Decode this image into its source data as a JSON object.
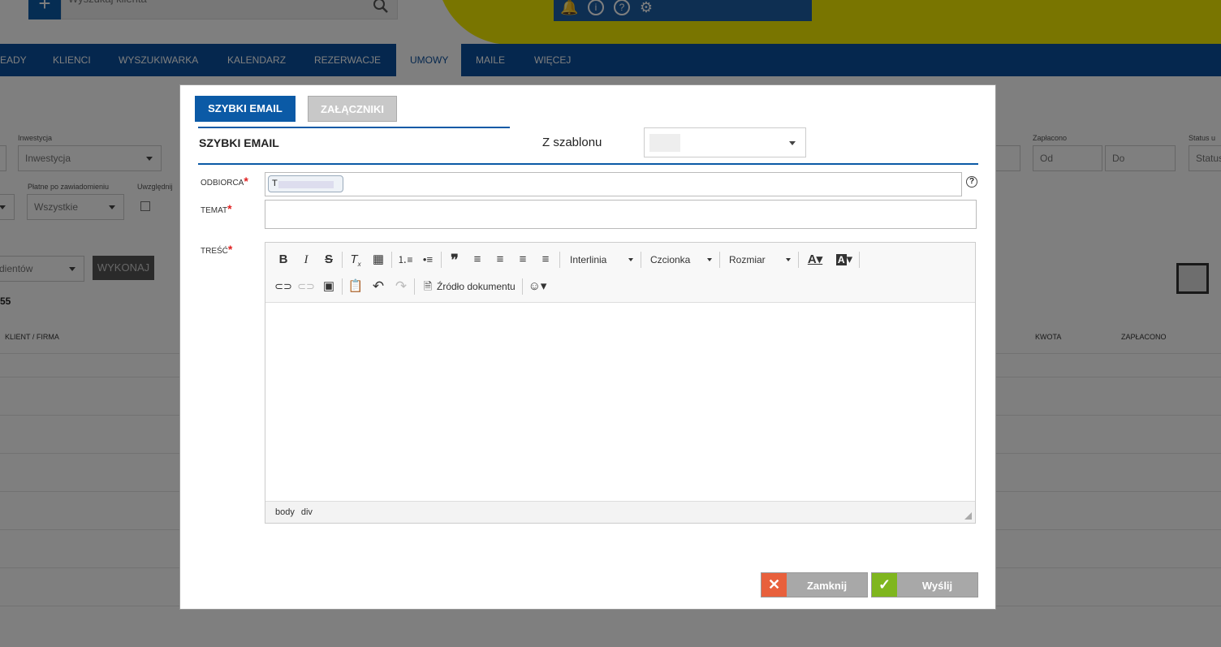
{
  "app": {
    "search_placeholder": "Wyszukaj klienta",
    "add_label": "+",
    "nav": [
      "EADY",
      "KLIENCI",
      "WYSZUKIWARKA",
      "KALENDARZ",
      "REZERWACJE",
      "UMOWY",
      "MAILE",
      "WIĘCEJ"
    ],
    "active_nav": "UMOWY"
  },
  "filters": {
    "investment_label": "Inwestycja",
    "investment_value": "Inwestycja",
    "paid_after_label": "Płatne po zawiadomieniu",
    "paid_after_value": "Wszystkie",
    "include_label": "Uwzględnij",
    "paid_label": "Zapłacono",
    "from_placeholder": "Od",
    "to_placeholder": "Do",
    "status_label": "Status u",
    "status_value": "Status",
    "bulk_value": "dientów",
    "execute_label": "WYKONAJ",
    "count": "55"
  },
  "table": {
    "headers": [
      "KLIENT / FIRMA",
      "KWOTA",
      "ZAPŁACONO"
    ]
  },
  "modal": {
    "tabs": [
      "SZYBKI EMAIL",
      "ZAŁĄCZNIKI"
    ],
    "title": "SZYBKI EMAIL",
    "template_label": "Z szablonu",
    "fields": {
      "recipient_label": "ODBIORCA",
      "recipient_chip": "T",
      "subject_label": "TEMAT",
      "body_label": "TREŚĆ",
      "required_mark": "*"
    },
    "toolbar": {
      "line_height": "Interlinia",
      "font": "Czcionka",
      "size": "Rozmiar",
      "source": "Źródło dokumentu"
    },
    "path": [
      "body",
      "div"
    ],
    "help": "?",
    "close_label": "Zamknij",
    "send_label": "Wyślij"
  }
}
